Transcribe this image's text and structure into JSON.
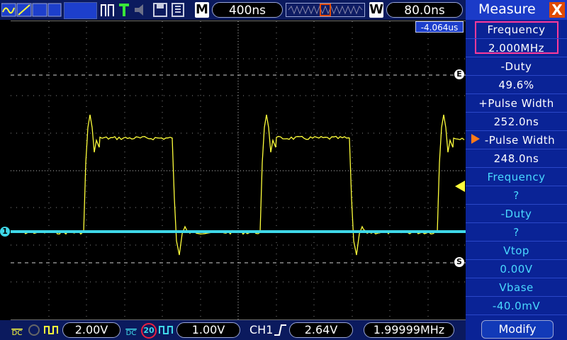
{
  "toolbar": {
    "timebase_marker": "M",
    "timebase": "400ns",
    "window_marker": "W",
    "window_value": "80.0ns",
    "trigger_time": "-4.064us"
  },
  "markers": {
    "e": "E",
    "s": "S",
    "ch1": "1"
  },
  "measure": {
    "title": "Measure",
    "close": "X",
    "items": [
      {
        "label": "Frequency",
        "value": "2.000MHz",
        "color": "white",
        "highlighted": true
      },
      {
        "label": "-Duty",
        "value": "49.6%",
        "color": "white"
      },
      {
        "label": "+Pulse Width",
        "value": "252.0ns",
        "color": "white"
      },
      {
        "label": "-Pulse Width",
        "value": "248.0ns",
        "color": "white",
        "selected": true
      },
      {
        "label": "Frequency",
        "value": "?",
        "color": "cyan"
      },
      {
        "label": "-Duty",
        "value": "?",
        "color": "cyan"
      },
      {
        "label": "Vtop",
        "value": "0.00V",
        "color": "cyan"
      },
      {
        "label": "Vbase",
        "value": "-40.0mV",
        "color": "cyan"
      }
    ],
    "modify": "Modify"
  },
  "bottom": {
    "ch1_coupling": "DC",
    "ch1_scale": "2.00V",
    "ch2_coupling": "DC",
    "ch2_bw": "20",
    "ch2_scale": "1.00V",
    "trigger_source": "CH1",
    "trigger_level": "2.64V",
    "frequency": "1.99999MHz"
  },
  "colors": {
    "ch1": "#ffff3b",
    "ch2": "#3fd8e8",
    "accent": "#e04a00",
    "panel": "#0a2396",
    "highlight": "#ff3a9a"
  }
}
